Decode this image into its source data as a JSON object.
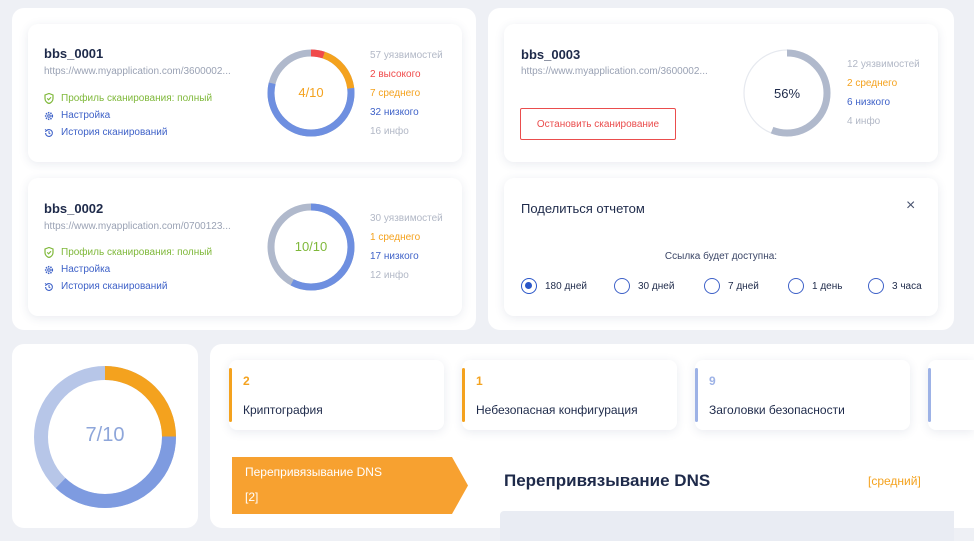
{
  "scans": [
    {
      "name": "bbs_0001",
      "url": "https://www.myapplication.com/3600002...",
      "profile": "Профиль сканирования: полный",
      "settings": "Настройка",
      "history": "История сканирований",
      "score": "4/10",
      "stats": [
        "57 уязвимостей",
        "2 высокого",
        "7 среднего",
        "32 низкого",
        "16 инфо"
      ]
    },
    {
      "name": "bbs_0002",
      "url": "https://www.myapplication.com/0700123...",
      "profile": "Профиль сканирования: полный",
      "settings": "Настройка",
      "history": "История сканирований",
      "score": "10/10",
      "stats": [
        "30 уязвимостей",
        "1 среднего",
        "17 низкого",
        "12 инфо"
      ]
    },
    {
      "name": "bbs_0003",
      "url": "https://www.myapplication.com/3600002...",
      "stop_button": "Остановить сканирование",
      "progress": "56%",
      "progress_value": 56,
      "stats": [
        "12 уязвимостей",
        "2 среднего",
        "6 низкого",
        "4 инфо"
      ]
    }
  ],
  "share": {
    "title": "Поделиться отчетом",
    "close": "×",
    "caption": "Ссылка будет доступна:",
    "options": [
      "180 дней",
      "30 дней",
      "7 дней",
      "1 день",
      "3 часа"
    ],
    "selected": "180 дней"
  },
  "summary": {
    "score": "7/10"
  },
  "categories": [
    {
      "count": "2",
      "name": "Криптография",
      "color": "#f4a21e"
    },
    {
      "count": "1",
      "name": "Небезопасная конфигурация",
      "color": "#f4a21e"
    },
    {
      "count": "9",
      "name": "Заголовки безопасности",
      "color": "#9db2e6"
    }
  ],
  "detail": {
    "tag_title": "Перепривязывание DNS",
    "tag_count": "[2]",
    "title": "Перепривязывание DNS",
    "severity": "[средний]"
  },
  "colors": {
    "high": "#f04a4a",
    "medium": "#f4a21e",
    "low": "#6e8fe0",
    "info": "#b0b9cc",
    "accent": "#2a56c8"
  }
}
